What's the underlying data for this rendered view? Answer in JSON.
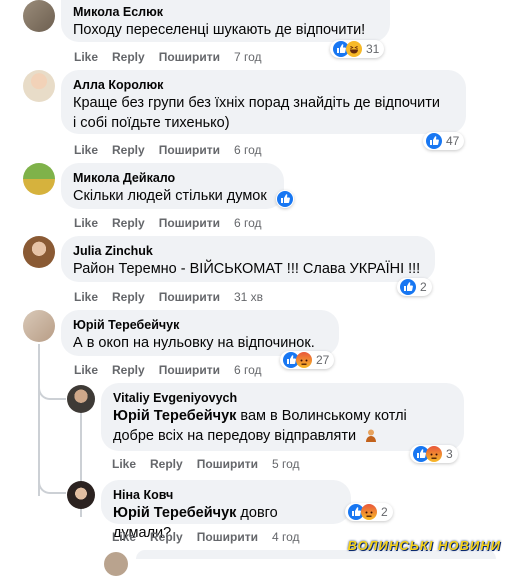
{
  "actions": {
    "like": "Like",
    "reply": "Reply",
    "share": "Поширити"
  },
  "comments": [
    {
      "author": "Микола Еслюк",
      "text": "Походу переселенці шукають де відпочити!",
      "time": "7 год",
      "reactions": [
        "like",
        "haha"
      ],
      "count": "31"
    },
    {
      "author": "Алла Королюк",
      "text_lines": [
        "Краще без групи без їхніх порад знайдіть де відпочити",
        "і собі поїдьте тихенько)"
      ],
      "time": "6 год",
      "reactions": [
        "like"
      ],
      "count": "47"
    },
    {
      "author": "Микола Дейкало",
      "text": "Скільки людей стільки думок",
      "time": "6 год",
      "reactions": [
        "like"
      ],
      "count": ""
    },
    {
      "author": "Julia Zinchuk",
      "text": "Район Теремно - ВІЙСЬКОМАТ !!! Слава УКРАЇНІ !!!",
      "time": "31 хв",
      "reactions": [
        "like"
      ],
      "count": "2"
    },
    {
      "author": "Юрій Теребейчук",
      "text": "А в окоп на нульовку на відпочинок.",
      "time": "6 год",
      "reactions": [
        "like",
        "angry"
      ],
      "count": "27"
    }
  ],
  "replies": [
    {
      "author": "Vitaliy Evgeniyovych",
      "mention": "Юрій Теребейчук",
      "text_line1": " вам в Волинському котлі",
      "text_line2": "добре всіх на передову відправляти",
      "emoji_alt": "person-emoji",
      "time": "5 год",
      "reactions": [
        "like",
        "angry"
      ],
      "count": "3"
    },
    {
      "author": "Ніна Ковч",
      "mention": "Юрій Теребейчук",
      "text": " довго думали?",
      "time": "4 год",
      "reactions": [
        "like",
        "angry"
      ],
      "count": "2"
    }
  ],
  "watermark": "ВОЛИНСЬКІ НОВИНИ",
  "colors": {
    "like": "#1877f2",
    "angry": "#f0652f",
    "haha": "#f7b928",
    "meta": "#65676b",
    "bubble": "#f0f2f5"
  }
}
